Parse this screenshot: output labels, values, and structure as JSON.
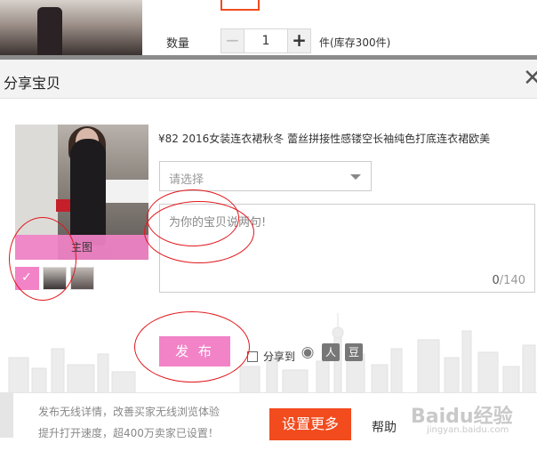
{
  "top": {
    "qty_label": "数量",
    "qty_minus": "−",
    "qty_value": "1",
    "qty_plus": "+",
    "stock_text": "件(库存300件)"
  },
  "modal": {
    "title": "分享宝贝",
    "close_icon": "close-icon",
    "main_image_label": "主图",
    "product_title": "¥82 2016女装连衣裙秋冬 蕾丝拼接性感镂空长袖纯色打底连衣裙欧美",
    "select_placeholder": "请选择",
    "textarea_placeholder": "为你的宝贝说两句!",
    "counter_current": "0",
    "counter_max": "/140",
    "publish_label": "发 布",
    "share_to_label": "分享到",
    "share_icons": [
      "weibo-icon",
      "renren-icon",
      "douban-icon"
    ],
    "share_glyphs": [
      "◉",
      "人",
      "豆"
    ]
  },
  "bottom": {
    "line1": "发布无线详情，改善买家无线浏览体验",
    "line2": "提升打开速度，超400万卖家已设置！",
    "settings_button": "设置更多",
    "help_link": "帮助"
  },
  "watermark": {
    "text": "Baidu经验",
    "subtext": "jingyan.baidu.com"
  },
  "colors": {
    "accent_pink": "#f283c7",
    "primary_orange": "#f24b1e",
    "annotation_red": "#e2161b"
  }
}
